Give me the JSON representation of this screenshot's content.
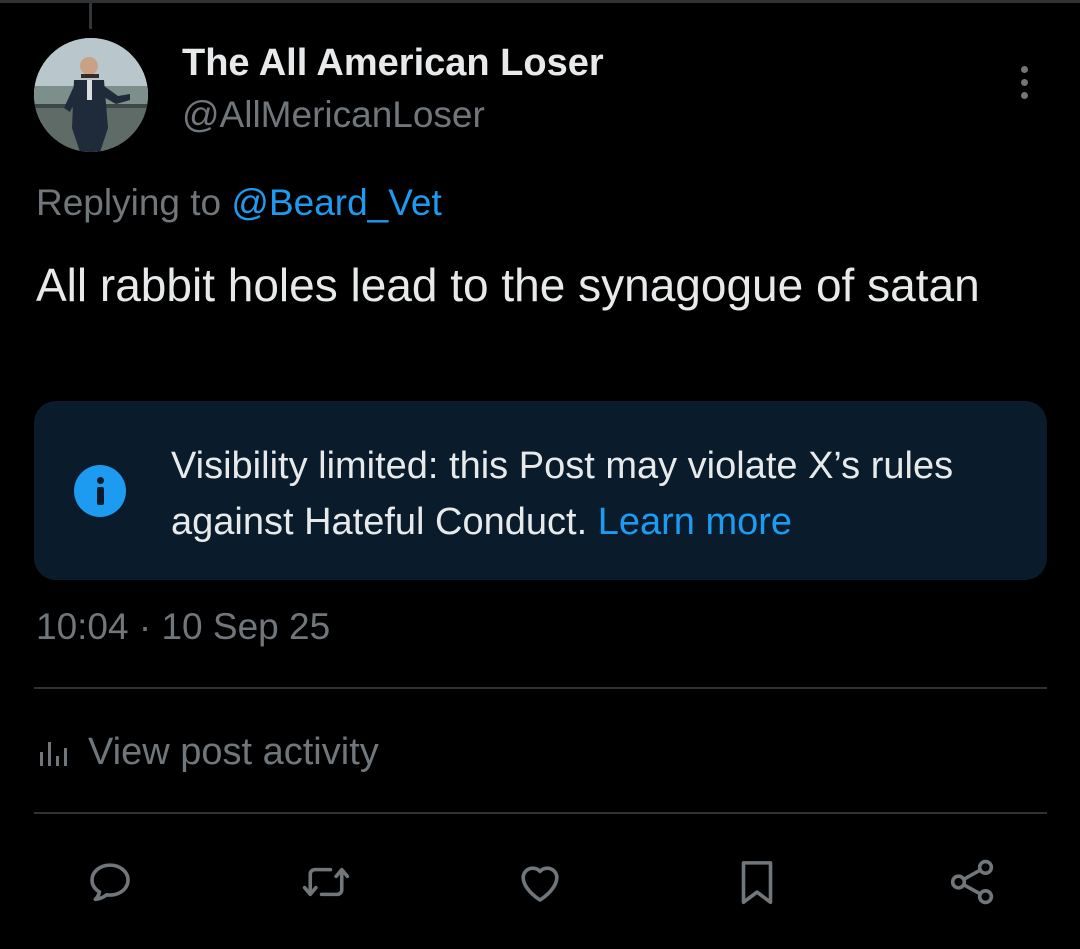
{
  "post": {
    "author": {
      "display_name": "The All American Loser",
      "handle": "@AllMericanLoser"
    },
    "replying_prefix": "Replying to",
    "replying_to": "@Beard_Vet",
    "text": "All rabbit holes lead to the synagogue of satan",
    "notice": {
      "message": "Visibility limited: this Post may violate X’s rules against Hateful Conduct.",
      "link": "Learn more",
      "icon": "info-icon"
    },
    "timestamp": "10:04 · 10 Sep 25",
    "activity_label": "View post activity"
  },
  "actions": [
    {
      "name": "reply",
      "icon": "reply-icon"
    },
    {
      "name": "repost",
      "icon": "repost-icon"
    },
    {
      "name": "like",
      "icon": "heart-icon"
    },
    {
      "name": "bookmark",
      "icon": "bookmark-icon"
    },
    {
      "name": "share",
      "icon": "share-icon"
    }
  ],
  "colors": {
    "background": "#000000",
    "text": "#e7e9ea",
    "secondary": "#71767b",
    "accent": "#1d9bf0",
    "notice_bg": "#0a1c2b"
  }
}
